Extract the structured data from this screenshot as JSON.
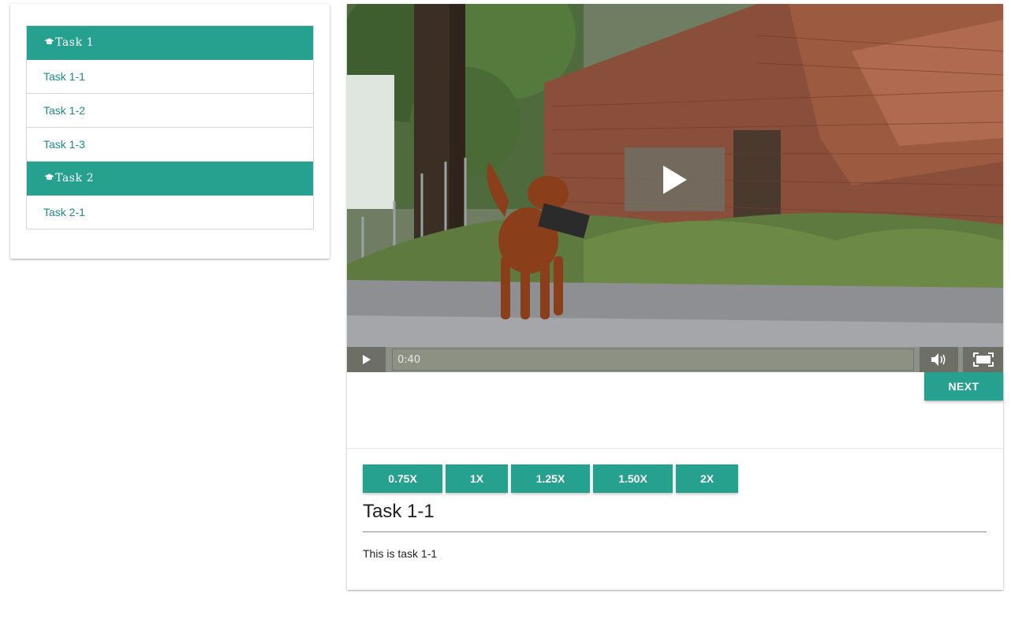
{
  "sidebar": {
    "sections": [
      {
        "title": "Task  1",
        "icon": "graduation-cap-icon",
        "items": [
          {
            "label": "Task 1-1"
          },
          {
            "label": "Task 1-2"
          },
          {
            "label": "Task 1-3"
          }
        ]
      },
      {
        "title": "Task  2",
        "icon": "graduation-cap-icon",
        "items": [
          {
            "label": "Task 2-1"
          }
        ]
      }
    ]
  },
  "video": {
    "time": "0:40",
    "icons": {
      "big_play": "play-icon",
      "play": "play-icon",
      "volume": "volume-icon",
      "fullscreen": "fullscreen-icon"
    }
  },
  "next_label": "NEXT",
  "speeds": [
    {
      "label": "0.75X"
    },
    {
      "label": "1X"
    },
    {
      "label": "1.25X"
    },
    {
      "label": "1.50X"
    },
    {
      "label": "2X"
    }
  ],
  "task": {
    "title": "Task 1-1",
    "description": "This is task 1-1"
  },
  "colors": {
    "accent": "#26a08f",
    "link": "#1f8c80"
  }
}
